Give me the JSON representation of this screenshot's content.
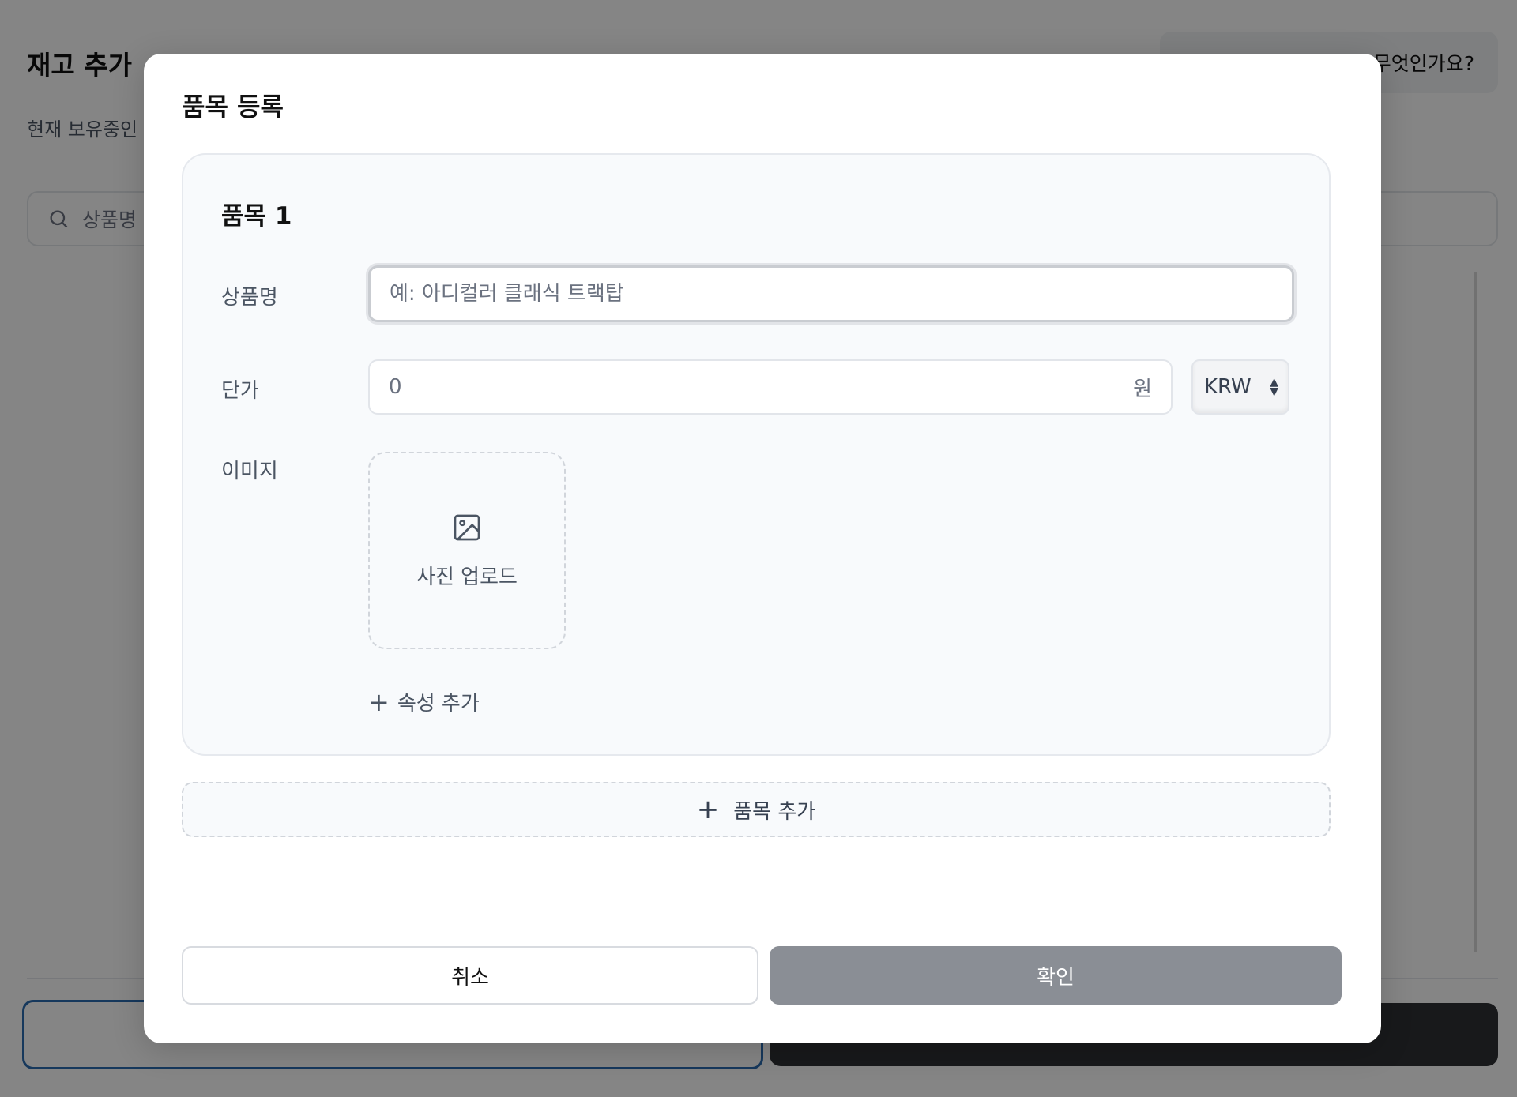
{
  "background": {
    "title": "재고 추가",
    "subtitle": "현재 보유중인",
    "help_text": "...무엇인가요?",
    "search_placeholder": "상품명",
    "left_button_label": "",
    "right_button_label": ""
  },
  "modal": {
    "title": "품목 등록",
    "item": {
      "title": "품목 1",
      "name_label": "상품명",
      "name_placeholder": "예: 아디컬러 클래식 트랙탑",
      "name_value": "",
      "price_label": "단가",
      "price_value": "0",
      "price_unit": "원",
      "currency": "KRW",
      "image_label": "이미지",
      "upload_label": "사진 업로드",
      "upload_icon": "image-icon",
      "add_attribute_label": "속성 추가"
    },
    "add_item_label": "품목 추가",
    "cancel_label": "취소",
    "confirm_label": "확인"
  },
  "colors": {
    "overlay": "#000000",
    "confirm_button": "#8a8e95",
    "card_background": "#f8fafc"
  }
}
